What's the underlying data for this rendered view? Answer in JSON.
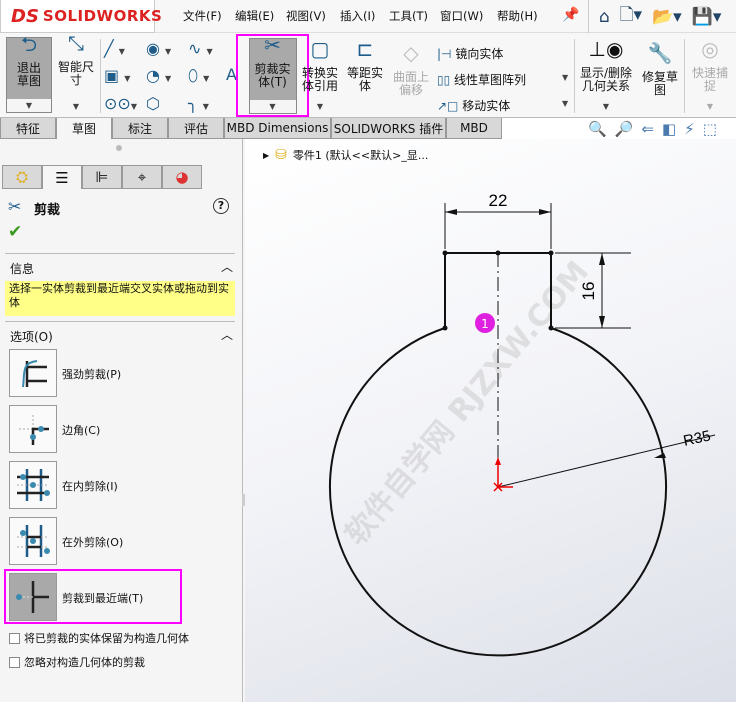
{
  "app": {
    "logo_text": "SOLIDWORKS",
    "logo_prefix": "3DS"
  },
  "menu": [
    "文件(F)",
    "编辑(E)",
    "视图(V)",
    "插入(I)",
    "工具(T)",
    "窗口(W)",
    "帮助(H)"
  ],
  "quick_icons": [
    "pin-icon",
    "home-icon",
    "new-document-icon",
    "open-icon",
    "save-icon"
  ],
  "ribbon": {
    "exit_sketch": "退出草图",
    "smart_dim": "智能尺寸",
    "trim": "剪裁实体(T)",
    "convert": "转换实体引用",
    "offset": "等距实体",
    "surface_offset": "曲面上偏移",
    "mirror": "镜向实体",
    "linear_pattern": "线性草图阵列",
    "move": "移动实体",
    "relations": "显示/删除几何关系",
    "repair": "修复草图",
    "quick_snap": "快速捕捉"
  },
  "tabs": [
    "特征",
    "草图",
    "标注",
    "评估",
    "MBD Dimensions",
    "SOLIDWORKS 插件",
    "MBD"
  ],
  "active_tab": "草图",
  "tree": {
    "part": "零件1  (默认<<默认>_显..."
  },
  "panel": {
    "title": "剪裁",
    "info_header": "信息",
    "info_text": "选择一实体剪裁到最近端交叉实体或拖动到实体",
    "options_header": "选项(O)",
    "options": [
      "强劲剪裁(P)",
      "边角(C)",
      "在内剪除(I)",
      "在外剪除(O)",
      "剪裁到最近端(T)"
    ],
    "selected_option": "剪裁到最近端(T)",
    "checkboxes": [
      {
        "label": "将已剪裁的实体保留为构造几何体",
        "checked": false
      },
      {
        "label": "忽略对构造几何体的剪裁",
        "checked": false
      }
    ]
  },
  "sketch": {
    "dim_width": "22",
    "dim_height": "16",
    "dim_radius": "R35",
    "marker": "1",
    "watermark": "软件自学网 RJZXW.COM"
  },
  "colors": {
    "highlight": "#ff00ff",
    "accent": "#1e5c8a",
    "info_bg": "#ffff88"
  }
}
